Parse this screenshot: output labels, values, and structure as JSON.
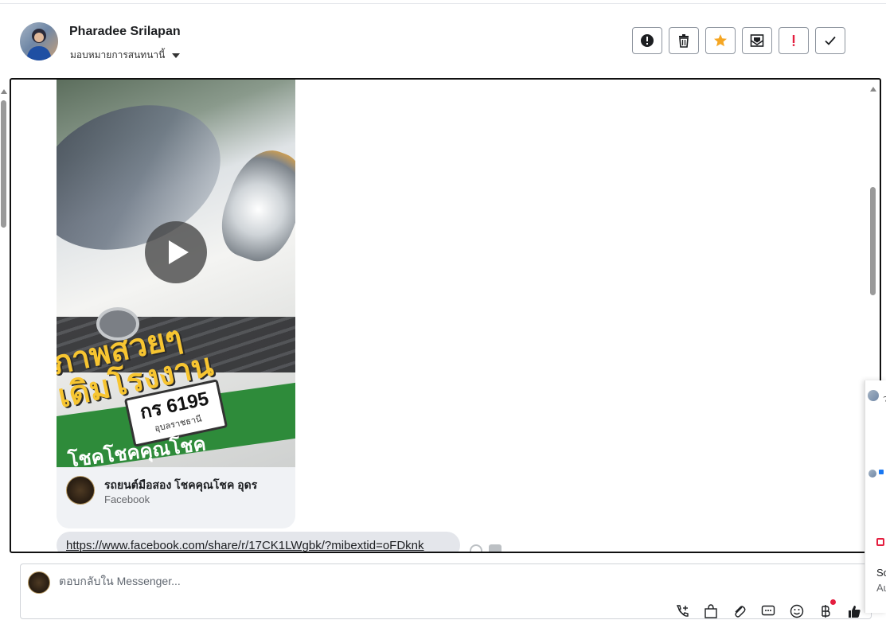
{
  "header": {
    "contact_name": "Pharadee Srilapan",
    "assign_label": "มอบหมายการสนทนานี้"
  },
  "actions": [
    {
      "name": "spam-button",
      "icon": "alert-circle-icon"
    },
    {
      "name": "delete-button",
      "icon": "trash-icon"
    },
    {
      "name": "star-button",
      "icon": "star-icon",
      "color": "#f5a623"
    },
    {
      "name": "mark-unread-button",
      "icon": "envelope-icon"
    },
    {
      "name": "follow-up-button",
      "icon": "exclamation-icon",
      "color": "#e41e3f"
    },
    {
      "name": "mark-done-button",
      "icon": "check-icon"
    }
  ],
  "message": {
    "media": {
      "overlay_line1": "ภาพสวยๆ",
      "overlay_line2": "เดิมโรงงาน",
      "plate_number": "กร 6195",
      "plate_province": "อุบลราชธานี",
      "band_text": "โชคโชคคุณโชค"
    },
    "source": {
      "title": "รถยนต์มือสอง โชคคุณโชค อุดร",
      "subtitle": "Facebook"
    },
    "link_text": "https://www.facebook.com/share/r/17CK1LWgbk/?mibextid=oFDknk"
  },
  "reply": {
    "placeholder": "ตอบกลับใน Messenger..."
  },
  "side_peek": {
    "text1": "So",
    "text2": "Au",
    "mark": "ว"
  },
  "colors": {
    "accent": "#1877f2",
    "star": "#f5a623",
    "alert": "#e41e3f"
  }
}
